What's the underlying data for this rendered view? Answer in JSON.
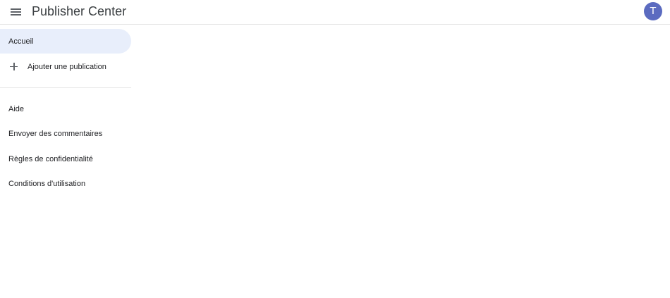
{
  "header": {
    "menu_icon": "menu-icon",
    "title": "Publisher Center",
    "avatar_initial": "T",
    "avatar_color": "#5b6bc0"
  },
  "sidebar": {
    "home": {
      "label": "Accueil",
      "active": true
    },
    "add_publication": {
      "label": "Ajouter une publication",
      "icon": "plus-icon"
    },
    "help": {
      "label": "Aide"
    },
    "feedback": {
      "label": "Envoyer des commentaires"
    },
    "privacy": {
      "label": "Règles de confidentialité"
    },
    "terms": {
      "label": "Conditions d'utilisation"
    }
  },
  "colors": {
    "active_item_bg": "#e8eefb",
    "divider": "#e3e3e3"
  }
}
